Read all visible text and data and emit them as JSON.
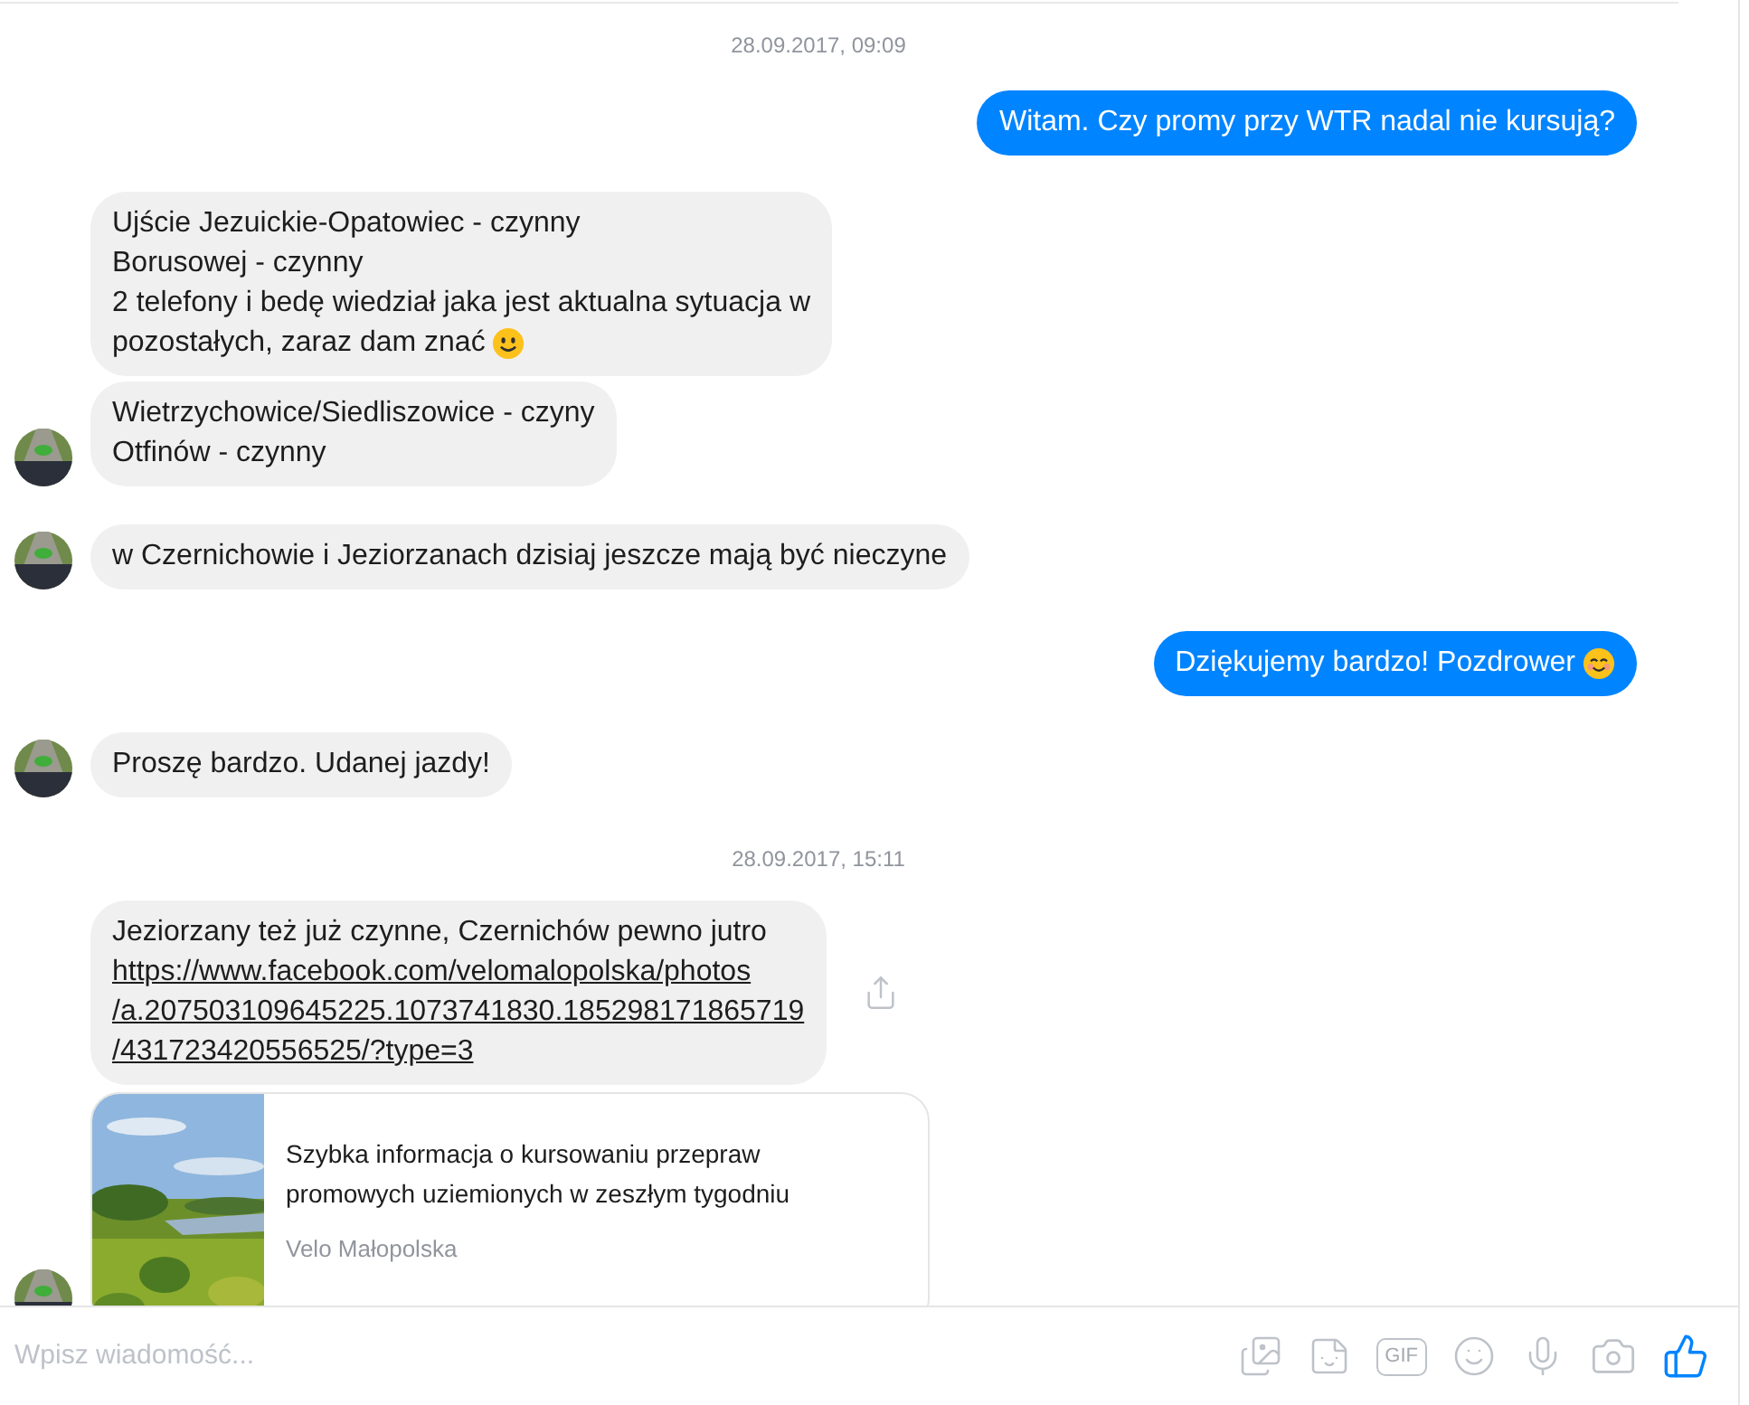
{
  "conversation": [
    {
      "kind": "timestamp",
      "text": "28.09.2017, 09:09"
    },
    {
      "kind": "outgoing",
      "bubbles": [
        {
          "lines": [
            "Witam. Czy promy przy WTR nadal nie kursują?"
          ]
        }
      ]
    },
    {
      "kind": "incoming",
      "bubbles": [
        {
          "lines": [
            "Ujście Jezuickie-Opatowiec - czynny",
            "Borusowej - czynny",
            "2 telefony i bedę wiedział jaka jest aktualna sytuacja w",
            "pozostałych, zaraz dam znać"
          ],
          "emoji": {
            "kind": "smile"
          }
        },
        {
          "lines": [
            "Wietrzychowice/Siedliszowice - czyny",
            "Otfinów - czynny"
          ]
        }
      ]
    },
    {
      "kind": "incoming",
      "bubbles": [
        {
          "lines": [
            "w Czernichowie i Jeziorzanach dzisiaj jeszcze mają być nieczyne"
          ]
        }
      ]
    },
    {
      "kind": "outgoing",
      "bubbles": [
        {
          "lines": [
            "Dziękujemy bardzo! Pozdrower"
          ],
          "emoji": {
            "kind": "blush"
          }
        }
      ]
    },
    {
      "kind": "incoming",
      "bubbles": [
        {
          "lines": [
            "Proszę bardzo. Udanej jazdy!"
          ]
        }
      ]
    },
    {
      "kind": "timestamp",
      "text": "28.09.2017, 15:11"
    },
    {
      "kind": "incoming",
      "bubbles": [
        {
          "lines": [
            "Jeziorzany też już czynne, Czernichów pewno jutro"
          ],
          "link_lines": [
            "https://www.facebook.com/velomalopolska/photos",
            "/a.207503109645225.1073741830.185298171865719",
            "/431723420556525/?type=3"
          ],
          "share": true
        }
      ],
      "preview": {
        "title_lines": [
          "Szybka informacja o kursowaniu przepraw",
          "promowych uziemionych w zeszłym tygodniu"
        ],
        "source": "Velo Małopolska"
      }
    }
  ],
  "composer": {
    "placeholder": "Wpisz wiadomość...",
    "gif_label": "GIF"
  }
}
